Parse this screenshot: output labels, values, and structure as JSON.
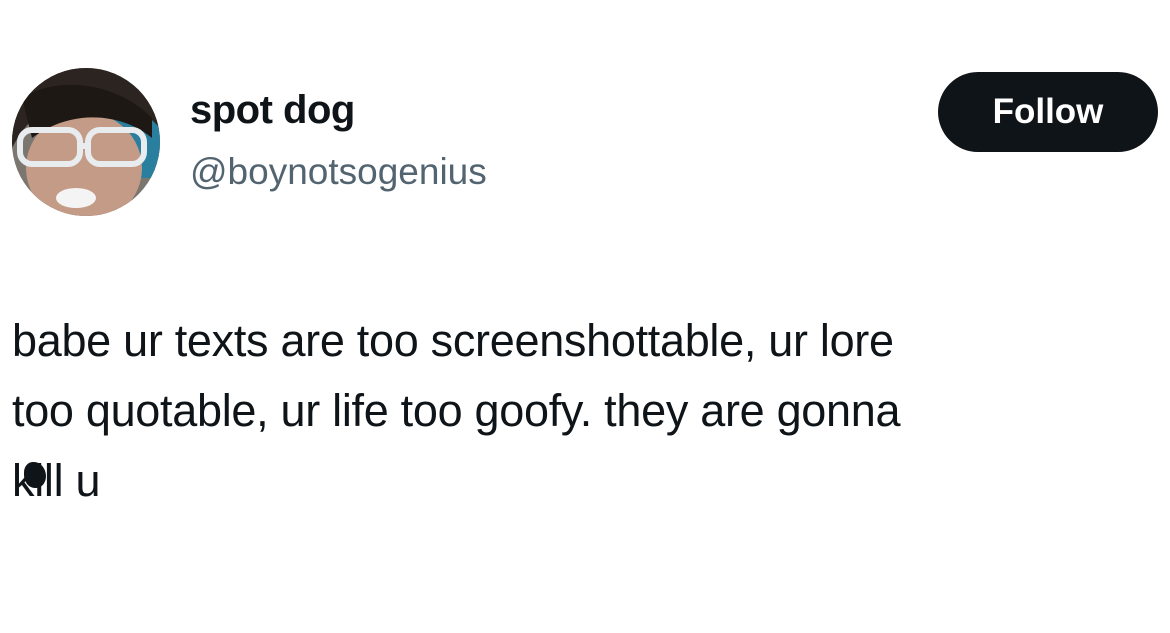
{
  "author": {
    "display_name": "spot dog",
    "handle": "@boynotsogenius",
    "avatar_icon": "user-avatar-photo"
  },
  "actions": {
    "follow_label": "Follow"
  },
  "tweet": {
    "lines": [
      "babe ur texts are too screenshottable, ur lore",
      "too quotable, ur life too goofy. they are gonna"
    ],
    "censored_word": "kill",
    "after_censored": " u"
  },
  "colors": {
    "text": "#0f1419",
    "secondary_text": "#536471",
    "button_bg": "#0f1419",
    "button_text": "#ffffff",
    "background": "#ffffff"
  }
}
